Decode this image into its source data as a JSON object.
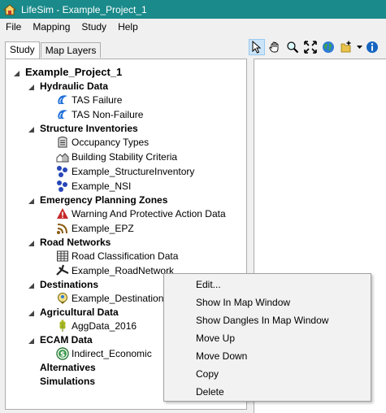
{
  "window": {
    "title": "LifeSim - Example_Project_1",
    "accent": "#1a8a8a"
  },
  "menubar": {
    "items": [
      "File",
      "Mapping",
      "Study",
      "Help"
    ]
  },
  "tabs": [
    {
      "label": "Study",
      "active": true
    },
    {
      "label": "Map Layers",
      "active": false
    }
  ],
  "tree": {
    "root": "Example_Project_1",
    "groups": {
      "hydraulic": {
        "label": "Hydraulic Data",
        "children": [
          "TAS Failure",
          "TAS Non-Failure"
        ]
      },
      "structure": {
        "label": "Structure Inventories",
        "children": [
          "Occupancy Types",
          "Building Stability Criteria",
          "Example_StructureInventory",
          "Example_NSI"
        ]
      },
      "epz": {
        "label": "Emergency Planning Zones",
        "children": [
          "Warning And Protective Action Data",
          "Example_EPZ"
        ]
      },
      "road": {
        "label": "Road Networks",
        "children": [
          "Road Classification Data",
          "Example_RoadNetwork"
        ]
      },
      "destinations": {
        "label": "Destinations",
        "children": [
          "Example_Destinations"
        ]
      },
      "agri": {
        "label": "Agricultural Data",
        "children": [
          "AggData_2016"
        ]
      },
      "ecam": {
        "label": "ECAM Data",
        "children": [
          "Indirect_Economic"
        ]
      },
      "alternatives": {
        "label": "Alternatives"
      },
      "simulations": {
        "label": "Simulations"
      }
    }
  },
  "context_menu": {
    "items": [
      "Edit...",
      "Show In Map Window",
      "Show Dangles In Map Window",
      "Move Up",
      "Move Down",
      "Copy",
      "Delete"
    ]
  },
  "toolbar": {
    "icons": [
      "select-arrow-icon",
      "pan-hand-icon",
      "zoom-icon",
      "zoom-extent-icon",
      "globe-icon",
      "add-layer-icon",
      "dropdown-arrow-icon",
      "info-icon"
    ]
  }
}
